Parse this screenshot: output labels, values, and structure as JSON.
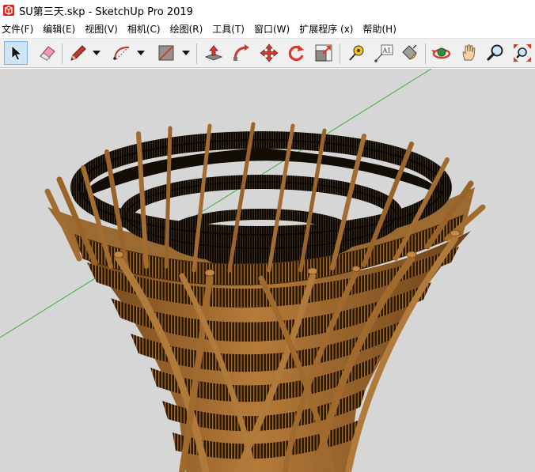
{
  "window": {
    "title": "SU第三天.skp - SketchUp Pro 2019",
    "app_icon": "sketchup-logo-icon"
  },
  "menu": [
    {
      "label": "文件(F)"
    },
    {
      "label": "编辑(E)"
    },
    {
      "label": "视图(V)"
    },
    {
      "label": "相机(C)"
    },
    {
      "label": "绘图(R)"
    },
    {
      "label": "工具(T)"
    },
    {
      "label": "窗口(W)"
    },
    {
      "label": "扩展程序 (x)"
    },
    {
      "label": "帮助(H)"
    }
  ],
  "toolbar": {
    "tools": [
      {
        "icon": "select-arrow-icon",
        "active": true
      },
      {
        "icon": "eraser-icon"
      },
      {
        "icon": "pencil-line-icon",
        "has_dropdown": true
      },
      {
        "icon": "arc-icon",
        "has_dropdown": true
      },
      {
        "icon": "rectangle-icon",
        "has_dropdown": true
      },
      {
        "icon": "push-pull-icon"
      },
      {
        "icon": "follow-me-icon"
      },
      {
        "icon": "move-icon"
      },
      {
        "icon": "rotate-icon"
      },
      {
        "icon": "scale-icon"
      },
      {
        "icon": "tape-measure-icon"
      },
      {
        "icon": "text-label-icon",
        "text": "A1"
      },
      {
        "icon": "paint-bucket-icon"
      },
      {
        "icon": "orbit-icon"
      },
      {
        "icon": "pan-hand-icon"
      },
      {
        "icon": "zoom-icon"
      },
      {
        "icon": "zoom-extents-icon"
      }
    ]
  },
  "viewport": {
    "background": "#d6d6d6",
    "axis_color": "#3cae3c",
    "wood_color": "#8a5a2b",
    "wood_light": "#b9823f",
    "rail_color": "#1a120a"
  }
}
